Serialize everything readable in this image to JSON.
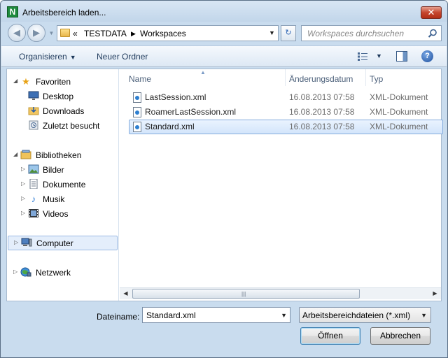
{
  "window": {
    "title": "Arbeitsbereich laden...",
    "close_glyph": "✕",
    "app_icon_letter": "N",
    "app_icon_color": "#1e8a3e"
  },
  "nav": {
    "back_glyph": "◀",
    "forward_glyph": "▶",
    "breadcrumb": [
      "«",
      "TESTDATA",
      "Workspaces"
    ],
    "refresh_glyph": "↻",
    "search_placeholder": "Workspaces durchsuchen"
  },
  "toolbar": {
    "organize_label": "Organisieren",
    "new_folder_label": "Neuer Ordner",
    "help_glyph": "?"
  },
  "sidebar": {
    "favorites": {
      "label": "Favoriten",
      "items": [
        "Desktop",
        "Downloads",
        "Zuletzt besucht"
      ]
    },
    "libraries": {
      "label": "Bibliotheken",
      "items": [
        "Bilder",
        "Dokumente",
        "Musik",
        "Videos"
      ]
    },
    "computer_label": "Computer",
    "network_label": "Netzwerk"
  },
  "file_list": {
    "columns": [
      "Name",
      "Änderungsdatum",
      "Typ"
    ],
    "rows": [
      {
        "name": "LastSession.xml",
        "date": "16.08.2013 07:58",
        "type": "XML-Dokument",
        "selected": false
      },
      {
        "name": "RoamerLastSession.xml",
        "date": "16.08.2013 07:58",
        "type": "XML-Dokument",
        "selected": false
      },
      {
        "name": "Standard.xml",
        "date": "16.08.2013 07:58",
        "type": "XML-Dokument",
        "selected": true
      }
    ]
  },
  "bottom": {
    "filename_label": "Dateiname:",
    "filename_value": "Standard.xml",
    "filter_value": "Arbeitsbereichdateien (*.xml)",
    "open_label": "Öffnen",
    "cancel_label": "Abbrechen"
  },
  "colors": {
    "chrome": "#c9dcee",
    "selection": "#d3e5fb",
    "accent": "#3c7fb1"
  }
}
